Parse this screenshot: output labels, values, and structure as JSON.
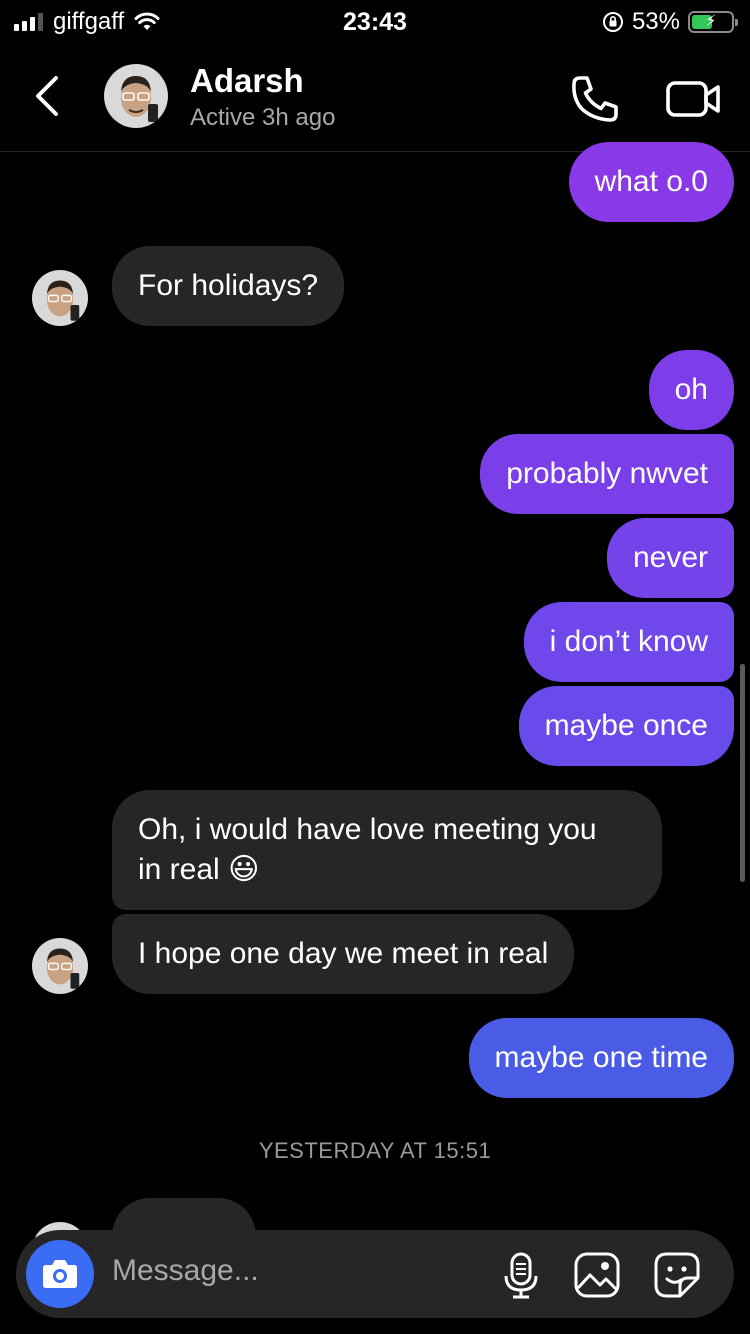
{
  "status_bar": {
    "carrier": "giffgaff",
    "time": "23:43",
    "battery_percent": "53%",
    "battery_level": 0.53
  },
  "header": {
    "name": "Adarsh",
    "status": "Active 3h ago"
  },
  "messages": [
    {
      "side": "out",
      "text": "what o.0"
    },
    {
      "side": "in",
      "text": "For holidays?"
    },
    {
      "side": "out",
      "text": "oh"
    },
    {
      "side": "out",
      "text": "probably nwvet"
    },
    {
      "side": "out",
      "text": "never"
    },
    {
      "side": "out",
      "text": "i don’t know"
    },
    {
      "side": "out",
      "text": "maybe once"
    },
    {
      "side": "in",
      "text_line1": "Oh, i would have love meeting you",
      "text_line2": "in real",
      "emoji": "😃"
    },
    {
      "side": "in",
      "text": "I hope one day we meet in real"
    },
    {
      "side": "out",
      "text": "maybe one time"
    }
  ],
  "date_separator": "YESTERDAY AT 15:51",
  "composer": {
    "placeholder": "Message..."
  },
  "colors": {
    "out_bubble_top": "#8a39e8",
    "out_bubble_mid": "#6f45ea",
    "out_bubble_bottom": "#4a5be6",
    "in_bubble": "#262626",
    "camera_button": "#3a6cf4"
  }
}
